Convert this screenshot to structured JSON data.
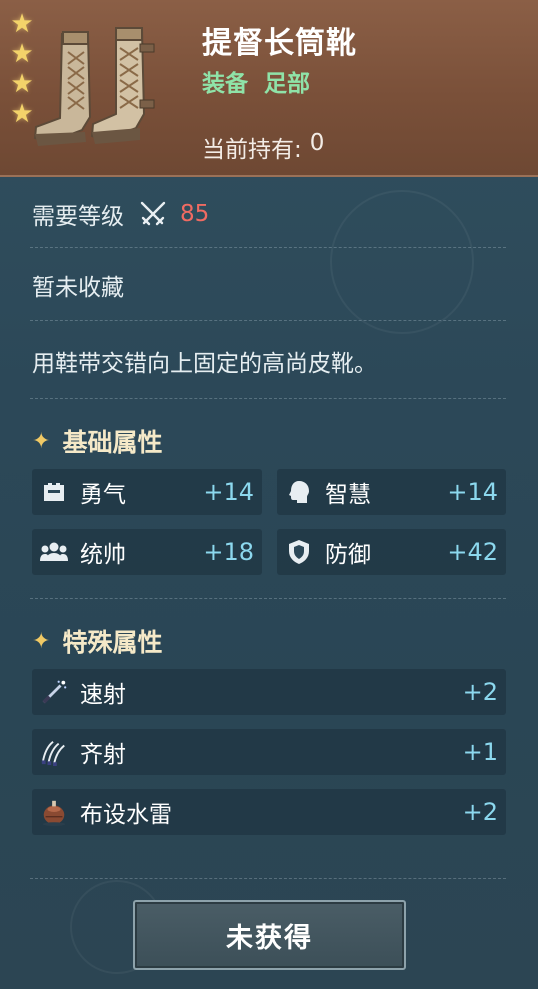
{
  "item": {
    "name": "提督长筒靴",
    "category_type": "装备",
    "category_slot": "足部",
    "holding_label": "当前持有:",
    "holding_value": "0",
    "stars": 4,
    "icon": "leather-boots-icon"
  },
  "requirement": {
    "label": "需要等级",
    "icon": "crossed-swords-icon",
    "level": "85"
  },
  "collection_status": "暂未收藏",
  "description": "用鞋带交错向上固定的高尚皮靴。",
  "basic_attributes": {
    "title": "基础属性",
    "items": [
      {
        "icon": "banner-icon",
        "label": "勇气",
        "value": "+14"
      },
      {
        "icon": "head-icon",
        "label": "智慧",
        "value": "+14"
      },
      {
        "icon": "group-icon",
        "label": "统帅",
        "value": "+18"
      },
      {
        "icon": "shield-icon",
        "label": "防御",
        "value": "+42"
      }
    ]
  },
  "special_attributes": {
    "title": "特殊属性",
    "items": [
      {
        "icon": "rapid-fire-icon",
        "label": "速射",
        "value": "+2"
      },
      {
        "icon": "volley-icon",
        "label": "齐射",
        "value": "+1"
      },
      {
        "icon": "sea-mine-icon",
        "label": "布设水雷",
        "value": "+2"
      }
    ]
  },
  "action_button": "未获得",
  "colors": {
    "header": "#7a5039",
    "star": "#f3d36a",
    "category": "#8fe3a8",
    "level": "#f06b62",
    "stat_value": "#8cd8ee"
  }
}
